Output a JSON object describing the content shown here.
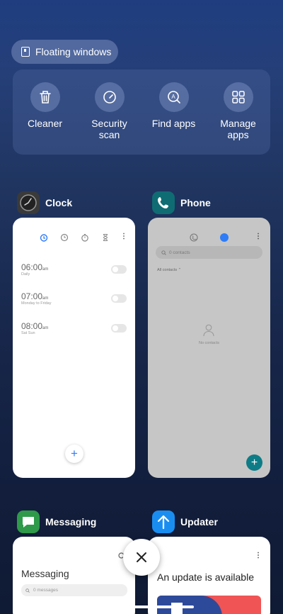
{
  "floating_windows": {
    "label": "Floating windows"
  },
  "tools": [
    {
      "label": "Cleaner",
      "icon": "trash-icon"
    },
    {
      "label": "Security scan",
      "icon": "security-gauge-icon"
    },
    {
      "label": "Find apps",
      "icon": "find-apps-icon"
    },
    {
      "label": "Manage apps",
      "icon": "grid-icon"
    }
  ],
  "apps": {
    "clock": {
      "title": "Clock",
      "alarms": [
        {
          "time": "06:00",
          "ampm": "am",
          "repeat": "Daily"
        },
        {
          "time": "07:00",
          "ampm": "am",
          "repeat": "Monday to Friday"
        },
        {
          "time": "08:00",
          "ampm": "am",
          "repeat": "Sat Sun"
        }
      ]
    },
    "phone": {
      "title": "Phone",
      "search_placeholder": "0 contacts",
      "filter": "All contacts",
      "empty": "No contacts"
    },
    "messaging": {
      "title": "Messaging",
      "heading": "Messaging",
      "search_placeholder": "0 messages"
    },
    "updater": {
      "title": "Updater",
      "heading": "An update is available"
    }
  },
  "colors": {
    "accent_blue": "#2f7cf6",
    "phone_fab": "#0e7c86",
    "updater_icon": "#1a8ef0"
  }
}
